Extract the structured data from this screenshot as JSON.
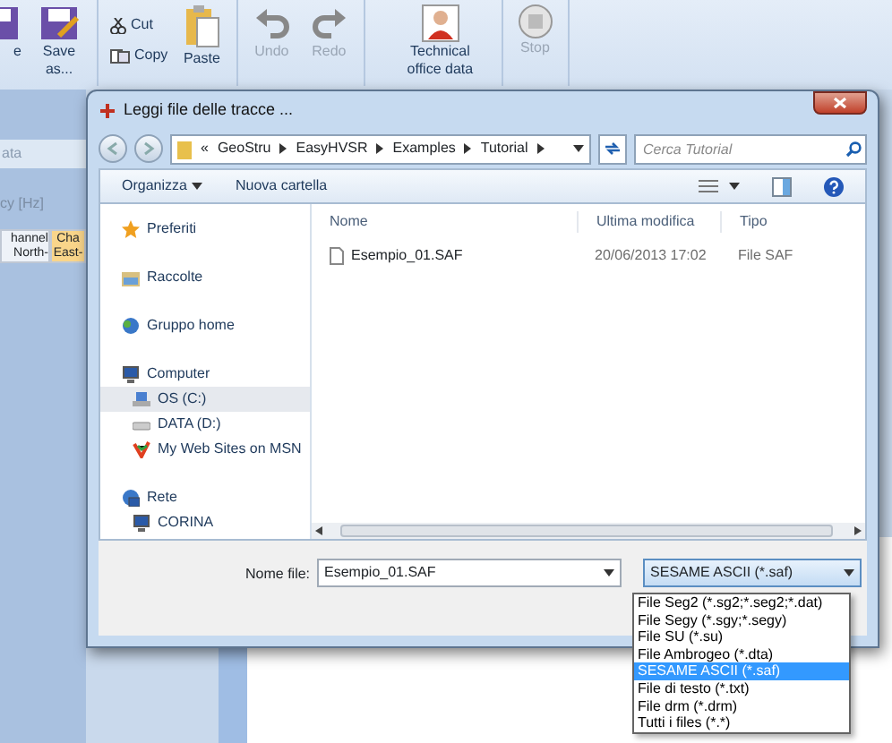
{
  "app": {
    "ribbon": [
      {
        "label": "e",
        "kind": "large",
        "disabled": false
      },
      {
        "label": "Save as...",
        "kind": "large",
        "disabled": false
      },
      {
        "label": "Cut",
        "kind": "small",
        "disabled": false
      },
      {
        "label": "Copy",
        "kind": "small",
        "disabled": false
      },
      {
        "label": "Paste",
        "kind": "large",
        "disabled": false
      },
      {
        "label": "Undo",
        "kind": "large",
        "disabled": true
      },
      {
        "label": "Redo",
        "kind": "large",
        "disabled": true
      },
      {
        "label": "Technical office data",
        "kind": "large",
        "disabled": false
      },
      {
        "label": "Stop",
        "kind": "large",
        "disabled": true
      }
    ],
    "panel": {
      "title": "ata",
      "axis_label": "cy [Hz]",
      "columns": [
        {
          "label": "hannel North-",
          "selected": false
        },
        {
          "label": "Cha East-",
          "selected": true
        }
      ]
    }
  },
  "dialog": {
    "title": "Leggi file delle tracce ...",
    "breadcrumb": {
      "overflow": "«",
      "parts": [
        "GeoStru",
        "EasyHVSR",
        "Examples",
        "Tutorial"
      ]
    },
    "search": {
      "placeholder": "Cerca Tutorial"
    },
    "toolbar": [
      "Organizza",
      "Nuova cartella"
    ],
    "nav": [
      {
        "label": "Preferiti"
      },
      {
        "label": "Raccolte"
      },
      {
        "label": "Gruppo home"
      },
      {
        "label": "Computer",
        "children": [
          {
            "label": "OS (C:)",
            "selected": true
          },
          {
            "label": "DATA (D:)",
            "selected": false
          },
          {
            "label": "My Web Sites on MSN",
            "selected": false
          }
        ]
      },
      {
        "label": "Rete",
        "children": [
          {
            "label": "CORINA",
            "selected": false
          }
        ]
      }
    ],
    "columns": [
      "Nome",
      "Ultima modifica",
      "Tipo"
    ],
    "files": [
      {
        "name": "Esempio_01.SAF",
        "modified": "20/06/2013 17:02",
        "type": "File SAF"
      }
    ],
    "filename_label": "Nome file:",
    "filename": "Esempio_01.SAF",
    "filetype": "SESAME ASCII (*.saf)",
    "filetype_options": [
      {
        "label": "File Seg2 (*.sg2;*.seg2;*.dat)",
        "selected": false
      },
      {
        "label": "File Segy (*.sgy;*.segy)",
        "selected": false
      },
      {
        "label": "File SU (*.su)",
        "selected": false
      },
      {
        "label": "File Ambrogeo (*.dta)",
        "selected": false
      },
      {
        "label": "SESAME ASCII (*.saf)",
        "selected": true
      },
      {
        "label": "File di testo (*.txt)",
        "selected": false
      },
      {
        "label": "File drm (*.drm)",
        "selected": false
      },
      {
        "label": "Tutti i files (*.*)",
        "selected": false
      }
    ]
  }
}
